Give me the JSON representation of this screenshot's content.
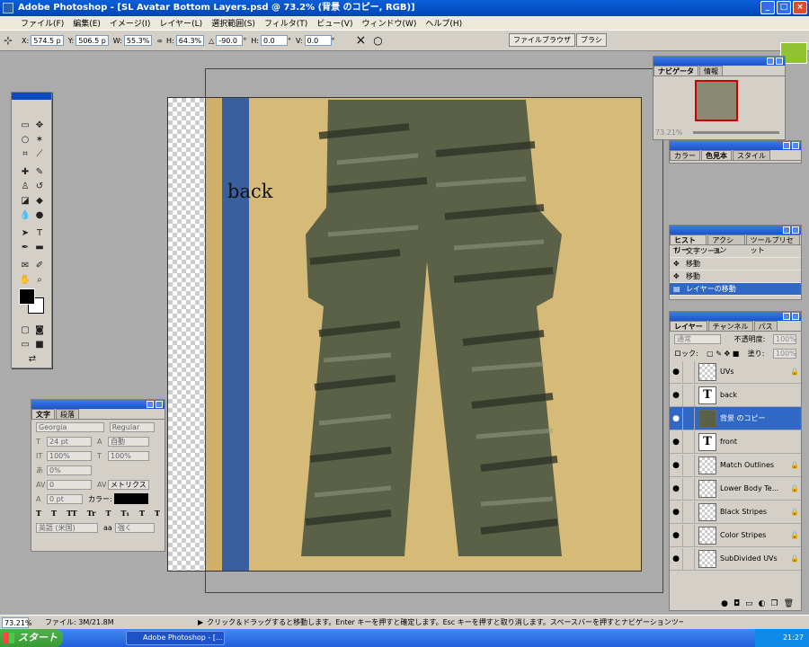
{
  "window": {
    "title": "Adobe Photoshop - [SL Avatar Bottom Layers.psd @ 73.2% (背景 のコピー, RGB)]",
    "buttons": [
      "_",
      "□",
      "×"
    ]
  },
  "menu": [
    "ファイル(F)",
    "編集(E)",
    "イメージ(I)",
    "レイヤー(L)",
    "選択範囲(S)",
    "フィルタ(T)",
    "ビュー(V)",
    "ウィンドウ(W)",
    "ヘルプ(H)"
  ],
  "options": {
    "x_label": "X:",
    "x": "574.5 p",
    "y_label": "Y:",
    "y": "506.5 p",
    "w_label": "W:",
    "w": "55.3%",
    "h_label": "H:",
    "h": "64.3%",
    "angle": "-90.0",
    "angle_unit": "°",
    "hskew_label": "H:",
    "hskew": "0.0",
    "vskew_label": "V:",
    "vskew": "0.0",
    "skew_unit": "°",
    "commit": "✓",
    "cancel_glyph": "×",
    "confirm_glyph": "○",
    "tab_browser": "ファイルブラウザ",
    "tab_brush": "ブラシ"
  },
  "canvas": {
    "text": "back",
    "colors": {
      "mat": "#d6ba78",
      "stripe": "#3a5f9e",
      "pants": "#5b6146"
    }
  },
  "character": {
    "tabs": [
      "文字",
      "段落"
    ],
    "font": "Georgia",
    "style": "Regular",
    "size": "24 pt",
    "leading": "自動",
    "vscale": "100%",
    "hscale": "100%",
    "tsume": "0%",
    "kerning": "0",
    "tracking": "メトリクス",
    "baseline": "0 pt",
    "color_label": "カラー:",
    "style_buttons": [
      "T",
      "T",
      "TT",
      "Tr",
      "T",
      "T₁",
      "T",
      "T"
    ],
    "language": "英語 (米国)",
    "aa_label": "aa",
    "aa": "強く"
  },
  "navigator": {
    "tabs": [
      "ナビゲータ",
      "情報"
    ],
    "zoom": "73.21%"
  },
  "color": {
    "tabs": [
      "カラー",
      "色見本",
      "スタイル"
    ]
  },
  "history": {
    "tabs": [
      "ヒストリー",
      "アクション",
      "ツールプリセット"
    ],
    "items": [
      "文字ツール",
      "移動",
      "移動",
      "レイヤーの移動"
    ],
    "selected": 3
  },
  "layers": {
    "tabs": [
      "レイヤー",
      "チャンネル",
      "パス"
    ],
    "blend": "通常",
    "opacity_label": "不透明度:",
    "opacity": "100%",
    "lock_label": "ロック:",
    "fill_label": "塗り:",
    "fill": "100%",
    "items": [
      {
        "name": "UVs",
        "type": "img",
        "locked": true
      },
      {
        "name": "back",
        "type": "text",
        "locked": false
      },
      {
        "name": "背景 のコピー",
        "type": "photo",
        "locked": false,
        "selected": true
      },
      {
        "name": "front",
        "type": "text",
        "locked": false
      },
      {
        "name": "Match Outlines",
        "type": "img",
        "locked": true
      },
      {
        "name": "Lower Body Te...",
        "type": "img",
        "locked": true
      },
      {
        "name": "Black Stripes",
        "type": "img",
        "locked": true
      },
      {
        "name": "Color Stripes",
        "type": "img",
        "locked": true
      },
      {
        "name": "SubDivided UVs",
        "type": "img",
        "locked": true
      }
    ]
  },
  "status": {
    "zoom": "73.21%",
    "file": "ファイル: 3M/21.8M",
    "hint": "クリック＆ドラッグすると移動します。Enter キーを押すと確定します。Esc キーを押すと取り消します。スペースバーを押すとナビゲーションツールが開きます。"
  },
  "taskbar": {
    "start": "スタート",
    "task": "Adobe Photoshop - [...",
    "time": "21:27"
  }
}
